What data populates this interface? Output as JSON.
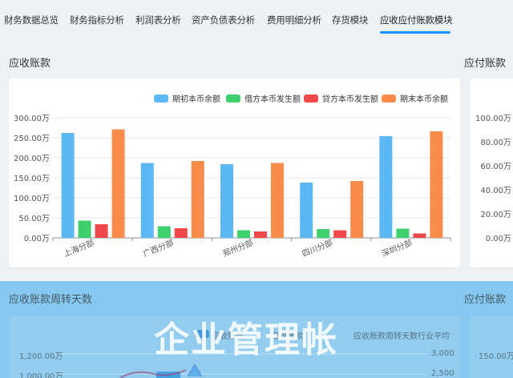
{
  "tabs": [
    {
      "label": "财务数据总览",
      "active": false
    },
    {
      "label": "财务指标分析",
      "active": false
    },
    {
      "label": "利润表分析",
      "active": false
    },
    {
      "label": "资产负债表分析",
      "active": false
    },
    {
      "label": "费用明细分析",
      "active": false
    },
    {
      "label": "存货模块",
      "active": false
    },
    {
      "label": "应收应付账款模块",
      "active": true
    }
  ],
  "sections": {
    "receivable_title": "应收账款",
    "payable_title": "应付账款",
    "receivable_turnover_title": "应收账款周转天数",
    "payable_turnover_title": "应付账款"
  },
  "watermark": "企业管理帐",
  "colors": {
    "opening": "#5bb8f5",
    "debit": "#3ecf6e",
    "credit": "#f04848",
    "closing": "#fa8c4b",
    "accent": "#1890ff"
  },
  "chart_data": [
    {
      "type": "bar",
      "title": "",
      "categories": [
        "上海分部",
        "广西分部",
        "郑州分部",
        "四川分部",
        "深圳分部"
      ],
      "series": [
        {
          "name": "期初本币余额",
          "values": [
            262,
            187,
            184,
            138,
            254
          ]
        },
        {
          "name": "借方本币发生额",
          "values": [
            43,
            29,
            19,
            22,
            23
          ]
        },
        {
          "name": "贷方本币发生额",
          "values": [
            34,
            24,
            16,
            19,
            11
          ]
        },
        {
          "name": "期末本币余额",
          "values": [
            271,
            192,
            187,
            142,
            266
          ]
        }
      ],
      "yticks": [
        "0.00万",
        "50.00万",
        "100.00万",
        "150.00万",
        "200.00万",
        "250.00万",
        "300.00万"
      ],
      "ylim": [
        0,
        300
      ],
      "grid": true,
      "legend": "top-right"
    },
    {
      "type": "bar",
      "title": "",
      "yticks": [
        "0.00万",
        "20.00万",
        "40.00万",
        "60.00万",
        "80.00万",
        "100.00万"
      ],
      "ylim": [
        0,
        100
      ],
      "grid": true
    }
  ],
  "turnover": {
    "legend_visible": [
      "应收账款",
      "应收账款",
      "应收账款周转天数行业平均"
    ],
    "left_ticks": [
      "1,200.00万",
      "1,000.00万"
    ],
    "right_ticks": [
      "3,000",
      "2,500"
    ],
    "payable_tick": "150.00万"
  }
}
